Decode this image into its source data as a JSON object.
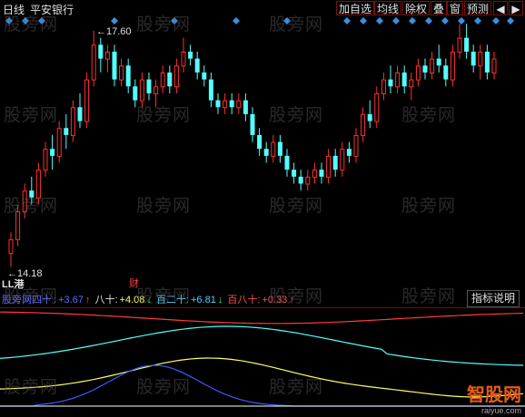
{
  "window": {
    "period": "日线",
    "stock": "平安银行"
  },
  "toolbar": [
    {
      "label": "加自选"
    },
    {
      "label": "均线"
    },
    {
      "label": "除权"
    },
    {
      "label": "叠"
    },
    {
      "label": "窗"
    },
    {
      "label": "预测"
    },
    {
      "label": "◀"
    },
    {
      "label": "▶"
    }
  ],
  "price_labels": {
    "high": "17.60",
    "low": "14.18",
    "marker_cai": "财",
    "marker_gang": "港"
  },
  "indicator": {
    "name": "股旁网四十",
    "v1": "+3.67",
    "l2": "八十:",
    "v2": "+4.08",
    "l3": "百二十:",
    "v3": "+6.81",
    "l4": "百八十:",
    "v4": "+0.33",
    "button": "指标说明"
  },
  "watermark": "股旁网",
  "logo": {
    "name": "智股网",
    "url": "raiyue.com"
  },
  "colors": {
    "up": "#ff3030",
    "down": "#54ffff",
    "separator": "#8b0000",
    "diamond": "#3b8fe0"
  },
  "chart_data": {
    "type": "candlestick",
    "high_label": 17.6,
    "low_label": 14.18,
    "candles": [
      {
        "o": 14.4,
        "c": 14.6,
        "h": 14.7,
        "l": 14.2
      },
      {
        "o": 14.6,
        "c": 15.0,
        "h": 15.1,
        "l": 14.5
      },
      {
        "o": 15.0,
        "c": 15.3,
        "h": 15.4,
        "l": 14.9
      },
      {
        "o": 15.3,
        "c": 15.2,
        "h": 15.5,
        "l": 15.1
      },
      {
        "o": 15.2,
        "c": 15.6,
        "h": 15.7,
        "l": 15.1
      },
      {
        "o": 15.6,
        "c": 15.9,
        "h": 16.0,
        "l": 15.5
      },
      {
        "o": 15.9,
        "c": 15.8,
        "h": 16.1,
        "l": 15.6
      },
      {
        "o": 15.8,
        "c": 16.2,
        "h": 16.3,
        "l": 15.7
      },
      {
        "o": 16.2,
        "c": 16.1,
        "h": 16.4,
        "l": 15.9
      },
      {
        "o": 16.1,
        "c": 16.5,
        "h": 16.6,
        "l": 16.0
      },
      {
        "o": 16.5,
        "c": 16.3,
        "h": 16.7,
        "l": 16.2
      },
      {
        "o": 16.3,
        "c": 16.9,
        "h": 17.0,
        "l": 16.2
      },
      {
        "o": 16.9,
        "c": 17.4,
        "h": 17.6,
        "l": 16.8
      },
      {
        "o": 17.4,
        "c": 17.2,
        "h": 17.5,
        "l": 17.0
      },
      {
        "o": 17.2,
        "c": 17.3,
        "h": 17.4,
        "l": 17.0
      },
      {
        "o": 17.3,
        "c": 16.9,
        "h": 17.4,
        "l": 16.8
      },
      {
        "o": 16.9,
        "c": 17.1,
        "h": 17.2,
        "l": 16.8
      },
      {
        "o": 17.1,
        "c": 16.8,
        "h": 17.2,
        "l": 16.7
      },
      {
        "o": 16.8,
        "c": 16.6,
        "h": 16.9,
        "l": 16.5
      },
      {
        "o": 16.6,
        "c": 16.9,
        "h": 17.0,
        "l": 16.5
      },
      {
        "o": 16.9,
        "c": 16.7,
        "h": 17.0,
        "l": 16.6
      },
      {
        "o": 16.7,
        "c": 16.8,
        "h": 16.9,
        "l": 16.5
      },
      {
        "o": 16.8,
        "c": 17.0,
        "h": 17.1,
        "l": 16.7
      },
      {
        "o": 17.0,
        "c": 16.8,
        "h": 17.1,
        "l": 16.7
      },
      {
        "o": 16.8,
        "c": 17.1,
        "h": 17.2,
        "l": 16.7
      },
      {
        "o": 17.1,
        "c": 17.3,
        "h": 17.5,
        "l": 17.0
      },
      {
        "o": 17.3,
        "c": 17.2,
        "h": 17.4,
        "l": 17.1
      },
      {
        "o": 17.2,
        "c": 17.0,
        "h": 17.3,
        "l": 16.9
      },
      {
        "o": 17.0,
        "c": 16.9,
        "h": 17.1,
        "l": 16.8
      },
      {
        "o": 16.9,
        "c": 16.6,
        "h": 17.0,
        "l": 16.5
      },
      {
        "o": 16.6,
        "c": 16.5,
        "h": 16.7,
        "l": 16.4
      },
      {
        "o": 16.5,
        "c": 16.6,
        "h": 16.7,
        "l": 16.4
      },
      {
        "o": 16.6,
        "c": 16.5,
        "h": 16.7,
        "l": 16.4
      },
      {
        "o": 16.5,
        "c": 16.6,
        "h": 16.7,
        "l": 16.4
      },
      {
        "o": 16.6,
        "c": 16.4,
        "h": 16.7,
        "l": 16.3
      },
      {
        "o": 16.4,
        "c": 16.1,
        "h": 16.5,
        "l": 16.0
      },
      {
        "o": 16.1,
        "c": 15.9,
        "h": 16.2,
        "l": 15.8
      },
      {
        "o": 15.9,
        "c": 15.8,
        "h": 16.0,
        "l": 15.7
      },
      {
        "o": 15.8,
        "c": 16.0,
        "h": 16.1,
        "l": 15.7
      },
      {
        "o": 16.0,
        "c": 15.8,
        "h": 16.1,
        "l": 15.7
      },
      {
        "o": 15.8,
        "c": 15.6,
        "h": 15.9,
        "l": 15.5
      },
      {
        "o": 15.6,
        "c": 15.5,
        "h": 15.7,
        "l": 15.4
      },
      {
        "o": 15.5,
        "c": 15.4,
        "h": 15.6,
        "l": 15.3
      },
      {
        "o": 15.4,
        "c": 15.5,
        "h": 15.6,
        "l": 15.3
      },
      {
        "o": 15.5,
        "c": 15.6,
        "h": 15.7,
        "l": 15.4
      },
      {
        "o": 15.6,
        "c": 15.5,
        "h": 15.7,
        "l": 15.4
      },
      {
        "o": 15.5,
        "c": 15.8,
        "h": 15.9,
        "l": 15.4
      },
      {
        "o": 15.8,
        "c": 15.6,
        "h": 15.9,
        "l": 15.5
      },
      {
        "o": 15.6,
        "c": 15.9,
        "h": 16.0,
        "l": 15.5
      },
      {
        "o": 15.9,
        "c": 15.8,
        "h": 16.0,
        "l": 15.7
      },
      {
        "o": 15.8,
        "c": 16.1,
        "h": 16.2,
        "l": 15.7
      },
      {
        "o": 16.1,
        "c": 16.4,
        "h": 16.5,
        "l": 16.0
      },
      {
        "o": 16.4,
        "c": 16.3,
        "h": 16.6,
        "l": 16.2
      },
      {
        "o": 16.3,
        "c": 16.7,
        "h": 16.8,
        "l": 16.2
      },
      {
        "o": 16.7,
        "c": 16.9,
        "h": 17.0,
        "l": 16.6
      },
      {
        "o": 16.9,
        "c": 16.8,
        "h": 17.1,
        "l": 16.7
      },
      {
        "o": 16.8,
        "c": 17.0,
        "h": 17.1,
        "l": 16.7
      },
      {
        "o": 17.0,
        "c": 16.8,
        "h": 17.1,
        "l": 16.7
      },
      {
        "o": 16.8,
        "c": 16.9,
        "h": 17.0,
        "l": 16.6
      },
      {
        "o": 16.9,
        "c": 17.1,
        "h": 17.2,
        "l": 16.8
      },
      {
        "o": 17.1,
        "c": 17.0,
        "h": 17.2,
        "l": 16.9
      },
      {
        "o": 17.0,
        "c": 17.2,
        "h": 17.3,
        "l": 16.9
      },
      {
        "o": 17.2,
        "c": 17.1,
        "h": 17.4,
        "l": 17.0
      },
      {
        "o": 17.1,
        "c": 16.9,
        "h": 17.2,
        "l": 16.8
      },
      {
        "o": 16.9,
        "c": 17.3,
        "h": 17.4,
        "l": 16.8
      },
      {
        "o": 17.3,
        "c": 17.5,
        "h": 17.7,
        "l": 17.2
      },
      {
        "o": 17.5,
        "c": 17.3,
        "h": 17.7,
        "l": 17.2
      },
      {
        "o": 17.3,
        "c": 17.1,
        "h": 17.4,
        "l": 17.0
      },
      {
        "o": 17.1,
        "c": 17.3,
        "h": 17.4,
        "l": 16.9
      },
      {
        "o": 17.3,
        "c": 17.0,
        "h": 17.4,
        "l": 16.9
      },
      {
        "o": 17.0,
        "c": 17.2,
        "h": 17.3,
        "l": 16.9
      }
    ]
  }
}
